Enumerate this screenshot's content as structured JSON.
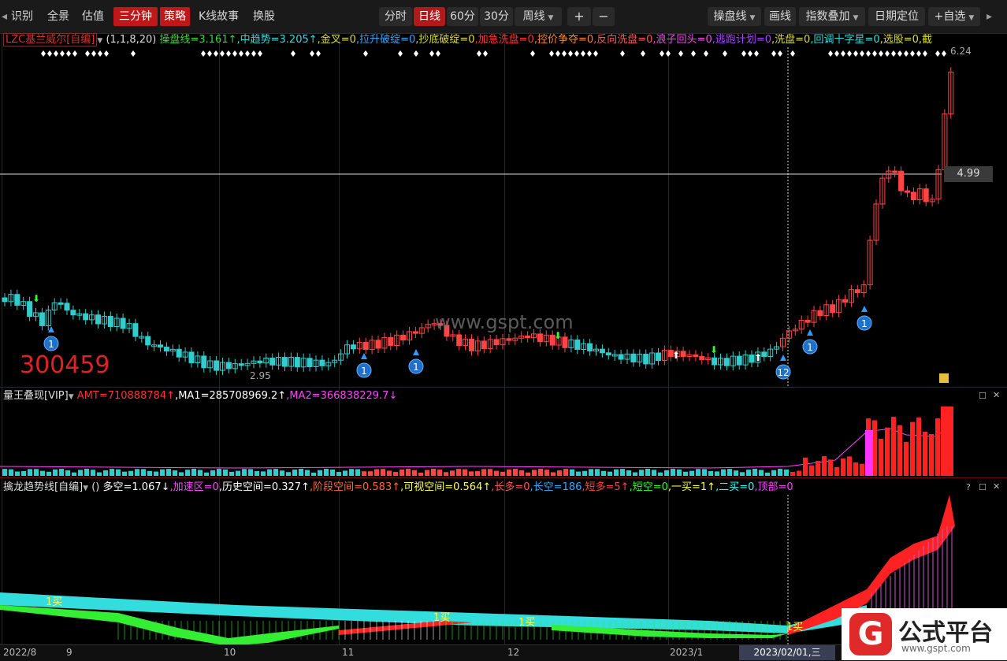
{
  "toolbar": {
    "items_left": [
      "识别",
      "全景",
      "估值"
    ],
    "san_fenzhong": "三分钟",
    "celue": "策略",
    "kline_story": "K线故事",
    "huangu": "换股",
    "periods": [
      "分时",
      "日线",
      "60分",
      "30分"
    ],
    "week": "周线",
    "plus": "+",
    "minus": "−",
    "right_items": {
      "caopan": "操盘线",
      "huaxian": "画线",
      "zhishu": "指数叠加",
      "riqi": "日期定位",
      "zixuan": "+自选"
    }
  },
  "main_panel": {
    "title": "LZC基兰威尔[自编]",
    "params": "(1,1,8,20)",
    "indicators": [
      {
        "text": "操盘线=3.161↑",
        "color": "#33dd33"
      },
      {
        "text": ",中趋势=3.205↑",
        "color": "#33dddd"
      },
      {
        "text": ",金叉=0",
        "color": "#dddd33"
      },
      {
        "text": ",拉升破绽=0",
        "color": "#33aaff"
      },
      {
        "text": ",抄底破绽=0",
        "color": "#dddd33"
      },
      {
        "text": ",加急洗盘=0",
        "color": "#ff3333"
      },
      {
        "text": ",控价争夺=0",
        "color": "#ff8833"
      },
      {
        "text": ",反向洗盘=0",
        "color": "#ff5555"
      },
      {
        "text": ",浪子回头=0",
        "color": "#ff44ff"
      },
      {
        "text": ",逃跑计划=0",
        "color": "#aa44ff"
      },
      {
        "text": ",洗盘=0",
        "color": "#dddd33"
      },
      {
        "text": ",回调十字星=0",
        "color": "#33dddd"
      },
      {
        "text": ",选股=0",
        "color": "#dddd33"
      },
      {
        "text": ",截",
        "color": "#dddd33"
      }
    ],
    "high_label": "6.24",
    "low_label": "2.95",
    "price_tag": "4.99",
    "watermark": "www.gspt.com",
    "stock_code": "300459",
    "signal_labels": [
      "1",
      "1",
      "1",
      "1",
      "12",
      "1"
    ]
  },
  "volume_panel": {
    "title": "量王叠现[VIP]",
    "amt": "AMT=710888784↑",
    "ma1": ",MA1=285708969.2↑",
    "ma2": ",MA2=366838229.7↓"
  },
  "trend_panel": {
    "title": "擒龙趋势线[自编]",
    "params": "()",
    "indicators": [
      {
        "text": "多空=1.067↓",
        "color": "#ffffff"
      },
      {
        "text": ",加速区=0",
        "color": "#ff44ff"
      },
      {
        "text": ",历史空间=0.327↑",
        "color": "#ffffff"
      },
      {
        "text": ",阶段空间=0.583↑",
        "color": "#ff6633"
      },
      {
        "text": ",可视空间=0.564↑",
        "color": "#ffff55"
      },
      {
        "text": ",长多=0",
        "color": "#ff5555"
      },
      {
        "text": ",长空=186",
        "color": "#33aaff"
      },
      {
        "text": ",短多=5↑",
        "color": "#ff4444"
      },
      {
        "text": ",短空=0",
        "color": "#33ff33"
      },
      {
        "text": ",一买=1↑",
        "color": "#ffff55"
      },
      {
        "text": ",二买=0",
        "color": "#33ffff"
      },
      {
        "text": ",顶部=0",
        "color": "#ff44ff"
      }
    ],
    "buy_labels": [
      "1买",
      "1买",
      "1买",
      "1买"
    ]
  },
  "xaxis": {
    "labels": [
      "2022/8",
      "9",
      "10",
      "11",
      "12",
      "2023/1"
    ],
    "current_date": "2023/02/01,三"
  },
  "logo": {
    "mark": "G",
    "text": "公式平台",
    "url": "www.gspt.com"
  },
  "colors": {
    "up": "#ff3333",
    "down": "#33cccc",
    "accent": "#c01818"
  }
}
